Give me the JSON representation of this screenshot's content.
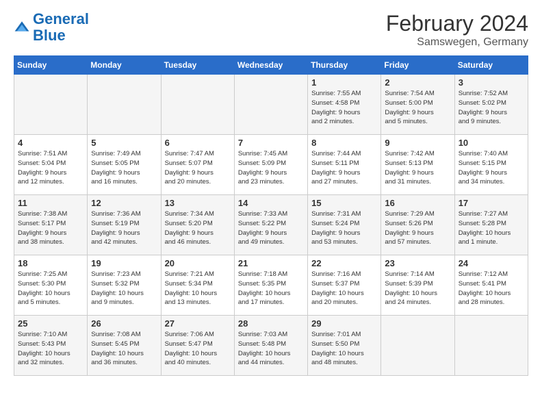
{
  "header": {
    "logo_line1": "General",
    "logo_line2": "Blue",
    "calendar_title": "February 2024",
    "calendar_subtitle": "Samswegen, Germany"
  },
  "days_of_week": [
    "Sunday",
    "Monday",
    "Tuesday",
    "Wednesday",
    "Thursday",
    "Friday",
    "Saturday"
  ],
  "weeks": [
    [
      {
        "day": "",
        "info": ""
      },
      {
        "day": "",
        "info": ""
      },
      {
        "day": "",
        "info": ""
      },
      {
        "day": "",
        "info": ""
      },
      {
        "day": "1",
        "info": "Sunrise: 7:55 AM\nSunset: 4:58 PM\nDaylight: 9 hours\nand 2 minutes."
      },
      {
        "day": "2",
        "info": "Sunrise: 7:54 AM\nSunset: 5:00 PM\nDaylight: 9 hours\nand 5 minutes."
      },
      {
        "day": "3",
        "info": "Sunrise: 7:52 AM\nSunset: 5:02 PM\nDaylight: 9 hours\nand 9 minutes."
      }
    ],
    [
      {
        "day": "4",
        "info": "Sunrise: 7:51 AM\nSunset: 5:04 PM\nDaylight: 9 hours\nand 12 minutes."
      },
      {
        "day": "5",
        "info": "Sunrise: 7:49 AM\nSunset: 5:05 PM\nDaylight: 9 hours\nand 16 minutes."
      },
      {
        "day": "6",
        "info": "Sunrise: 7:47 AM\nSunset: 5:07 PM\nDaylight: 9 hours\nand 20 minutes."
      },
      {
        "day": "7",
        "info": "Sunrise: 7:45 AM\nSunset: 5:09 PM\nDaylight: 9 hours\nand 23 minutes."
      },
      {
        "day": "8",
        "info": "Sunrise: 7:44 AM\nSunset: 5:11 PM\nDaylight: 9 hours\nand 27 minutes."
      },
      {
        "day": "9",
        "info": "Sunrise: 7:42 AM\nSunset: 5:13 PM\nDaylight: 9 hours\nand 31 minutes."
      },
      {
        "day": "10",
        "info": "Sunrise: 7:40 AM\nSunset: 5:15 PM\nDaylight: 9 hours\nand 34 minutes."
      }
    ],
    [
      {
        "day": "11",
        "info": "Sunrise: 7:38 AM\nSunset: 5:17 PM\nDaylight: 9 hours\nand 38 minutes."
      },
      {
        "day": "12",
        "info": "Sunrise: 7:36 AM\nSunset: 5:19 PM\nDaylight: 9 hours\nand 42 minutes."
      },
      {
        "day": "13",
        "info": "Sunrise: 7:34 AM\nSunset: 5:20 PM\nDaylight: 9 hours\nand 46 minutes."
      },
      {
        "day": "14",
        "info": "Sunrise: 7:33 AM\nSunset: 5:22 PM\nDaylight: 9 hours\nand 49 minutes."
      },
      {
        "day": "15",
        "info": "Sunrise: 7:31 AM\nSunset: 5:24 PM\nDaylight: 9 hours\nand 53 minutes."
      },
      {
        "day": "16",
        "info": "Sunrise: 7:29 AM\nSunset: 5:26 PM\nDaylight: 9 hours\nand 57 minutes."
      },
      {
        "day": "17",
        "info": "Sunrise: 7:27 AM\nSunset: 5:28 PM\nDaylight: 10 hours\nand 1 minute."
      }
    ],
    [
      {
        "day": "18",
        "info": "Sunrise: 7:25 AM\nSunset: 5:30 PM\nDaylight: 10 hours\nand 5 minutes."
      },
      {
        "day": "19",
        "info": "Sunrise: 7:23 AM\nSunset: 5:32 PM\nDaylight: 10 hours\nand 9 minutes."
      },
      {
        "day": "20",
        "info": "Sunrise: 7:21 AM\nSunset: 5:34 PM\nDaylight: 10 hours\nand 13 minutes."
      },
      {
        "day": "21",
        "info": "Sunrise: 7:18 AM\nSunset: 5:35 PM\nDaylight: 10 hours\nand 17 minutes."
      },
      {
        "day": "22",
        "info": "Sunrise: 7:16 AM\nSunset: 5:37 PM\nDaylight: 10 hours\nand 20 minutes."
      },
      {
        "day": "23",
        "info": "Sunrise: 7:14 AM\nSunset: 5:39 PM\nDaylight: 10 hours\nand 24 minutes."
      },
      {
        "day": "24",
        "info": "Sunrise: 7:12 AM\nSunset: 5:41 PM\nDaylight: 10 hours\nand 28 minutes."
      }
    ],
    [
      {
        "day": "25",
        "info": "Sunrise: 7:10 AM\nSunset: 5:43 PM\nDaylight: 10 hours\nand 32 minutes."
      },
      {
        "day": "26",
        "info": "Sunrise: 7:08 AM\nSunset: 5:45 PM\nDaylight: 10 hours\nand 36 minutes."
      },
      {
        "day": "27",
        "info": "Sunrise: 7:06 AM\nSunset: 5:47 PM\nDaylight: 10 hours\nand 40 minutes."
      },
      {
        "day": "28",
        "info": "Sunrise: 7:03 AM\nSunset: 5:48 PM\nDaylight: 10 hours\nand 44 minutes."
      },
      {
        "day": "29",
        "info": "Sunrise: 7:01 AM\nSunset: 5:50 PM\nDaylight: 10 hours\nand 48 minutes."
      },
      {
        "day": "",
        "info": ""
      },
      {
        "day": "",
        "info": ""
      }
    ]
  ]
}
